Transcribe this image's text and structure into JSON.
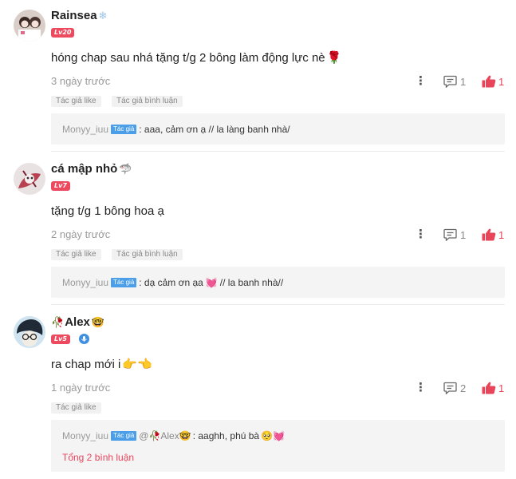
{
  "labels": {
    "author_like": "Tác giả like",
    "author_reply": "Tác giả bình luận",
    "author_badge": "Tác giả"
  },
  "colors": {
    "accent": "#e8455b",
    "level_badge": "#ee4a5f",
    "author_badge": "#4b9ee8"
  },
  "comments": [
    {
      "username": "Rainsea",
      "username_emoji": "❄",
      "level": "Lv20",
      "text": "hóng chap sau nhá tặng t/g 2 bông làm động lực nè",
      "text_emoji": "🌹",
      "time": "3 ngày trước",
      "reply_count": "1",
      "like_count": "1",
      "tags": [
        "Tác giả like",
        "Tác giả bình luận"
      ],
      "reply": {
        "author": "Monyy_iuu",
        "text": ": aaa, cảm ơn ạ // la làng banh nhà/"
      }
    },
    {
      "username": "cá mập nhỏ",
      "username_emoji": "🦈",
      "level": "Lv7",
      "text": "tặng t/g 1 bông hoa ạ",
      "time": "2 ngày trước",
      "reply_count": "1",
      "like_count": "1",
      "tags": [
        "Tác giả like",
        "Tác giả bình luận"
      ],
      "reply": {
        "author": "Monyy_iuu",
        "text_before": ": dạ cảm ơn ạa",
        "emoji": "💓",
        "text_after": "// la banh nhà//"
      }
    },
    {
      "username": "Alex",
      "username_prefix_emoji": "🥀",
      "username_emoji": "🤓",
      "level": "Lv5",
      "text": "ra chap mới i",
      "text_emoji": "👉👈",
      "time": "1 ngày trước",
      "reply_count": "2",
      "like_count": "1",
      "tags": [
        "Tác giả like"
      ],
      "reply": {
        "author": "Monyy_iuu",
        "mention": "@🥀Alex🤓",
        "text": ": aaghh, phú bà",
        "emoji": "🥺💓"
      },
      "total_replies": "Tổng 2 bình luận"
    }
  ]
}
